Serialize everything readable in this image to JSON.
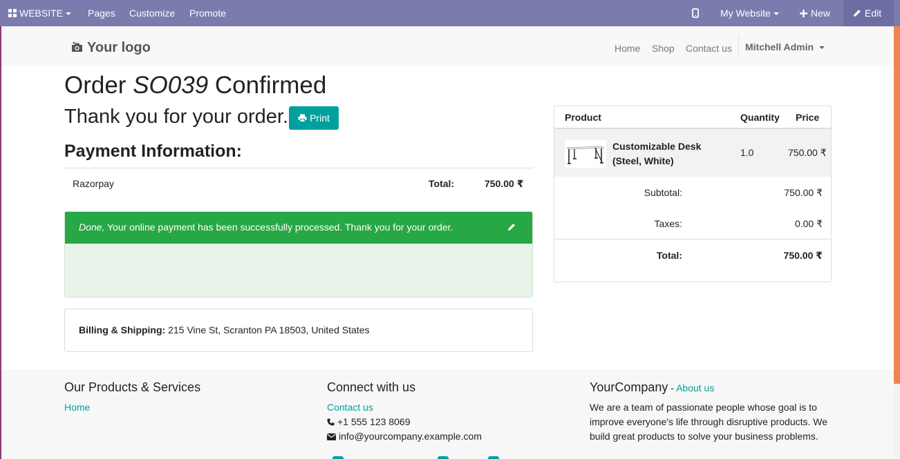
{
  "topbar": {
    "website_menu": "WEBSITE",
    "pages": "Pages",
    "customize": "Customize",
    "promote": "Promote",
    "my_website": "My Website",
    "new": "New",
    "edit": "Edit"
  },
  "header": {
    "logo": "Your logo",
    "nav": [
      "Home",
      "Shop",
      "Contact us"
    ],
    "user": "Mitchell Admin"
  },
  "order": {
    "title_prefix": "Order ",
    "number": "SO039",
    "title_suffix": " Confirmed",
    "thank_you": "Thank you for your order.",
    "print_label": "Print"
  },
  "payment": {
    "heading": "Payment Information:",
    "method": "Razorpay",
    "total_label": "Total:",
    "total_value": "750.00 ₹",
    "status_word": "Done,",
    "status_message": " Your online payment has been successfully processed. Thank you for your order."
  },
  "billing": {
    "label": "Billing & Shipping:",
    "address": " 215 Vine St, Scranton PA 18503, United States"
  },
  "summary": {
    "col_product": "Product",
    "col_quantity": "Quantity",
    "col_price": "Price",
    "product_name_line1": "Customizable Desk",
    "product_name_line2": "(Steel, White)",
    "product_qty": "1.0",
    "product_price": "750.00 ₹",
    "subtotal_label": "Subtotal:",
    "subtotal_value": "750.00 ₹",
    "taxes_label": "Taxes:",
    "taxes_value": "0.00 ₹",
    "total_label": "Total:",
    "total_value": "750.00 ₹"
  },
  "footer": {
    "products_heading": "Our Products & Services",
    "products_link": "Home",
    "connect_heading": "Connect with us",
    "contact_link": "Contact us",
    "phone": "+1 555 123 8069",
    "email": "info@yourcompany.example.com",
    "company_heading": "YourCompany",
    "company_sep": " - ",
    "about_link": "About us",
    "company_text": "We are a team of passionate people whose goal is to improve everyone's life through disruptive products. We build great products to solve your business problems."
  },
  "colors": {
    "topbar": "#7c7bad",
    "primary": "#00a09d",
    "success": "#28a745",
    "scrollbar": "#f0844f"
  }
}
